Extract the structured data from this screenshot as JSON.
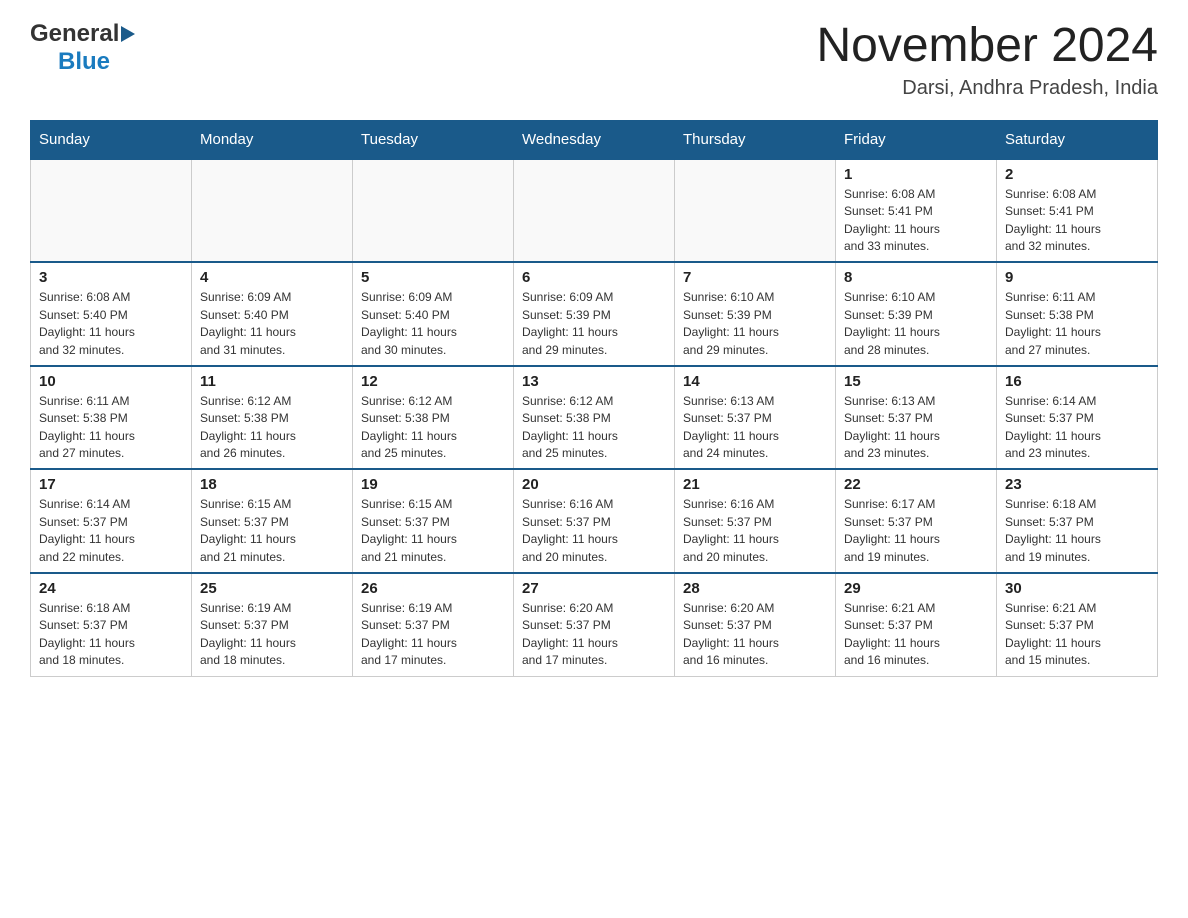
{
  "header": {
    "logo": {
      "general_text": "General",
      "blue_text": "Blue"
    },
    "title": "November 2024",
    "subtitle": "Darsi, Andhra Pradesh, India"
  },
  "days_of_week": [
    "Sunday",
    "Monday",
    "Tuesday",
    "Wednesday",
    "Thursday",
    "Friday",
    "Saturday"
  ],
  "weeks": [
    [
      {
        "day": "",
        "info": ""
      },
      {
        "day": "",
        "info": ""
      },
      {
        "day": "",
        "info": ""
      },
      {
        "day": "",
        "info": ""
      },
      {
        "day": "",
        "info": ""
      },
      {
        "day": "1",
        "info": "Sunrise: 6:08 AM\nSunset: 5:41 PM\nDaylight: 11 hours\nand 33 minutes."
      },
      {
        "day": "2",
        "info": "Sunrise: 6:08 AM\nSunset: 5:41 PM\nDaylight: 11 hours\nand 32 minutes."
      }
    ],
    [
      {
        "day": "3",
        "info": "Sunrise: 6:08 AM\nSunset: 5:40 PM\nDaylight: 11 hours\nand 32 minutes."
      },
      {
        "day": "4",
        "info": "Sunrise: 6:09 AM\nSunset: 5:40 PM\nDaylight: 11 hours\nand 31 minutes."
      },
      {
        "day": "5",
        "info": "Sunrise: 6:09 AM\nSunset: 5:40 PM\nDaylight: 11 hours\nand 30 minutes."
      },
      {
        "day": "6",
        "info": "Sunrise: 6:09 AM\nSunset: 5:39 PM\nDaylight: 11 hours\nand 29 minutes."
      },
      {
        "day": "7",
        "info": "Sunrise: 6:10 AM\nSunset: 5:39 PM\nDaylight: 11 hours\nand 29 minutes."
      },
      {
        "day": "8",
        "info": "Sunrise: 6:10 AM\nSunset: 5:39 PM\nDaylight: 11 hours\nand 28 minutes."
      },
      {
        "day": "9",
        "info": "Sunrise: 6:11 AM\nSunset: 5:38 PM\nDaylight: 11 hours\nand 27 minutes."
      }
    ],
    [
      {
        "day": "10",
        "info": "Sunrise: 6:11 AM\nSunset: 5:38 PM\nDaylight: 11 hours\nand 27 minutes."
      },
      {
        "day": "11",
        "info": "Sunrise: 6:12 AM\nSunset: 5:38 PM\nDaylight: 11 hours\nand 26 minutes."
      },
      {
        "day": "12",
        "info": "Sunrise: 6:12 AM\nSunset: 5:38 PM\nDaylight: 11 hours\nand 25 minutes."
      },
      {
        "day": "13",
        "info": "Sunrise: 6:12 AM\nSunset: 5:38 PM\nDaylight: 11 hours\nand 25 minutes."
      },
      {
        "day": "14",
        "info": "Sunrise: 6:13 AM\nSunset: 5:37 PM\nDaylight: 11 hours\nand 24 minutes."
      },
      {
        "day": "15",
        "info": "Sunrise: 6:13 AM\nSunset: 5:37 PM\nDaylight: 11 hours\nand 23 minutes."
      },
      {
        "day": "16",
        "info": "Sunrise: 6:14 AM\nSunset: 5:37 PM\nDaylight: 11 hours\nand 23 minutes."
      }
    ],
    [
      {
        "day": "17",
        "info": "Sunrise: 6:14 AM\nSunset: 5:37 PM\nDaylight: 11 hours\nand 22 minutes."
      },
      {
        "day": "18",
        "info": "Sunrise: 6:15 AM\nSunset: 5:37 PM\nDaylight: 11 hours\nand 21 minutes."
      },
      {
        "day": "19",
        "info": "Sunrise: 6:15 AM\nSunset: 5:37 PM\nDaylight: 11 hours\nand 21 minutes."
      },
      {
        "day": "20",
        "info": "Sunrise: 6:16 AM\nSunset: 5:37 PM\nDaylight: 11 hours\nand 20 minutes."
      },
      {
        "day": "21",
        "info": "Sunrise: 6:16 AM\nSunset: 5:37 PM\nDaylight: 11 hours\nand 20 minutes."
      },
      {
        "day": "22",
        "info": "Sunrise: 6:17 AM\nSunset: 5:37 PM\nDaylight: 11 hours\nand 19 minutes."
      },
      {
        "day": "23",
        "info": "Sunrise: 6:18 AM\nSunset: 5:37 PM\nDaylight: 11 hours\nand 19 minutes."
      }
    ],
    [
      {
        "day": "24",
        "info": "Sunrise: 6:18 AM\nSunset: 5:37 PM\nDaylight: 11 hours\nand 18 minutes."
      },
      {
        "day": "25",
        "info": "Sunrise: 6:19 AM\nSunset: 5:37 PM\nDaylight: 11 hours\nand 18 minutes."
      },
      {
        "day": "26",
        "info": "Sunrise: 6:19 AM\nSunset: 5:37 PM\nDaylight: 11 hours\nand 17 minutes."
      },
      {
        "day": "27",
        "info": "Sunrise: 6:20 AM\nSunset: 5:37 PM\nDaylight: 11 hours\nand 17 minutes."
      },
      {
        "day": "28",
        "info": "Sunrise: 6:20 AM\nSunset: 5:37 PM\nDaylight: 11 hours\nand 16 minutes."
      },
      {
        "day": "29",
        "info": "Sunrise: 6:21 AM\nSunset: 5:37 PM\nDaylight: 11 hours\nand 16 minutes."
      },
      {
        "day": "30",
        "info": "Sunrise: 6:21 AM\nSunset: 5:37 PM\nDaylight: 11 hours\nand 15 minutes."
      }
    ]
  ]
}
